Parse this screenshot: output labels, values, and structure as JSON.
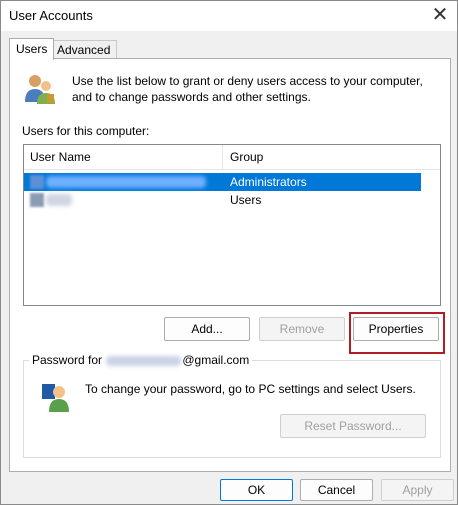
{
  "window": {
    "title": "User Accounts"
  },
  "tabs": [
    {
      "label": "Users",
      "selected": true
    },
    {
      "label": "Advanced",
      "selected": false
    }
  ],
  "info": {
    "text": "Use the list below to grant or deny users access to your computer, and to change passwords and other settings."
  },
  "users_section": {
    "label": "Users for this computer:"
  },
  "table": {
    "columns": [
      "User Name",
      "Group"
    ],
    "rows": [
      {
        "user_name": "",
        "group": "Administrators",
        "selected": true
      },
      {
        "user_name": "",
        "group": "Users",
        "selected": false
      }
    ]
  },
  "buttons": {
    "add": "Add...",
    "remove": "Remove",
    "properties": "Properties",
    "reset_password": "Reset Password...",
    "ok": "OK",
    "cancel": "Cancel",
    "apply": "Apply"
  },
  "password_group": {
    "label_prefix": "Password for ",
    "label_suffix": "@gmail.com",
    "text": "To change your password, go to PC settings and select Users."
  },
  "colors": {
    "selection": "#0078d7",
    "highlight_box": "#b01e23"
  }
}
